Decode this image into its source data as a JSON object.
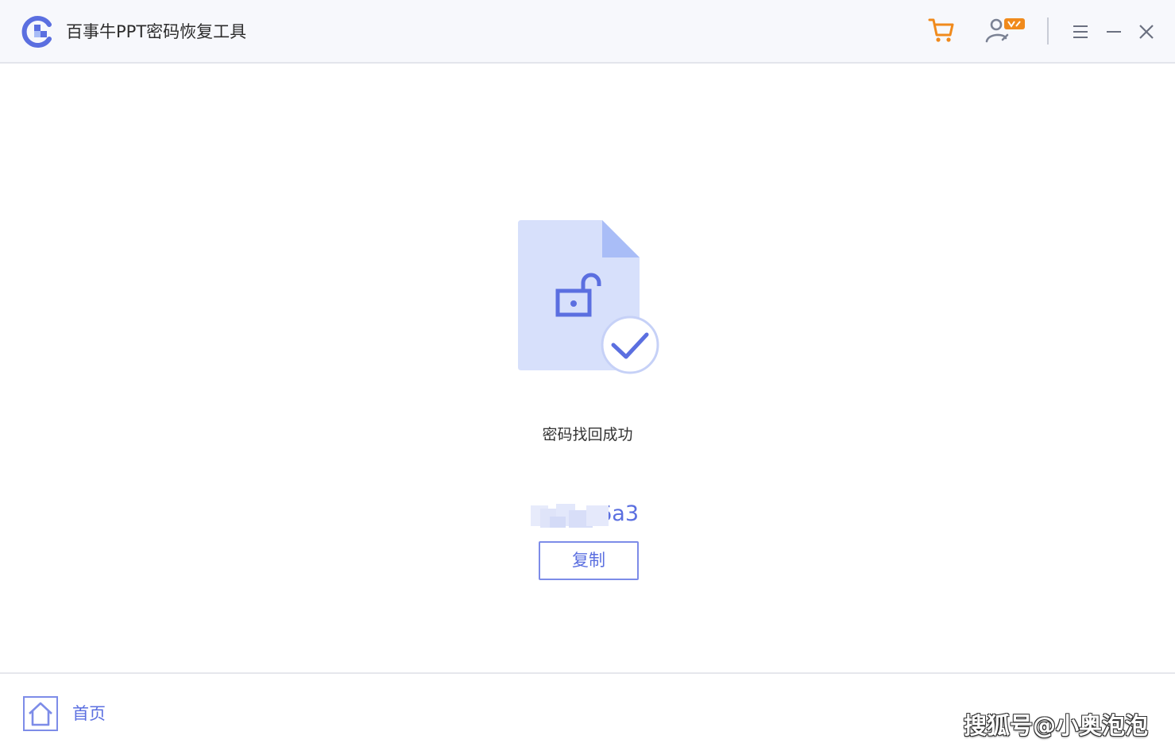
{
  "app": {
    "title": "百事牛PPT密码恢复工具",
    "logo_icon": "app-logo-icon"
  },
  "titlebar": {
    "icons": [
      "cart-icon",
      "user-vip-icon",
      "menu-icon",
      "minimize-icon",
      "close-icon"
    ]
  },
  "result": {
    "status": "密码找回成功",
    "password_visible_suffix": "6a3",
    "copy_label": "复制"
  },
  "footer": {
    "home_label": "首页",
    "watermark": "搜狐号@小奥泡泡"
  },
  "colors": {
    "accent": "#5b6fe0",
    "cart": "#f08a1c",
    "doc_fill": "#d7e0fb",
    "doc_fold": "#a9bdf7"
  }
}
